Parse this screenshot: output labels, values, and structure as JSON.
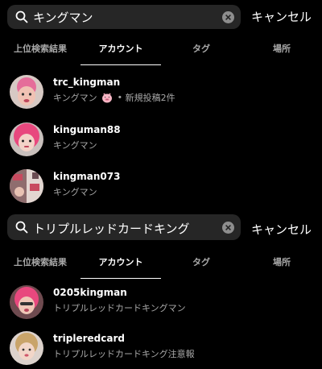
{
  "panel_a": {
    "search": {
      "query": "キングマン",
      "cancel_label": "キャンセル"
    },
    "tabs": [
      "上位検索結果",
      "アカウント",
      "タグ",
      "場所"
    ],
    "results": [
      {
        "username": "trc_kingman",
        "display": "キングマン",
        "extra": "新規投稿2件",
        "has_pig": true
      },
      {
        "username": "kinguman88",
        "display": "キングマン"
      },
      {
        "username": "kingman073",
        "display": "キングマン"
      }
    ]
  },
  "panel_b": {
    "search": {
      "query": "トリプルレッドカードキング",
      "cancel_label": "キャンセル"
    },
    "tabs": [
      "上位検索結果",
      "アカウント",
      "タグ",
      "場所"
    ],
    "results": [
      {
        "username": "0205kingman",
        "display": "トリプルレッドカードキングマン"
      },
      {
        "username": "tripleredcard",
        "display": "トリプルレッドカードキング注意報"
      }
    ]
  },
  "colors": {
    "background": "#000000",
    "searchbar": "#262626",
    "secondary_text": "#a8a8a8",
    "avatar_pink": "#e8487e"
  }
}
